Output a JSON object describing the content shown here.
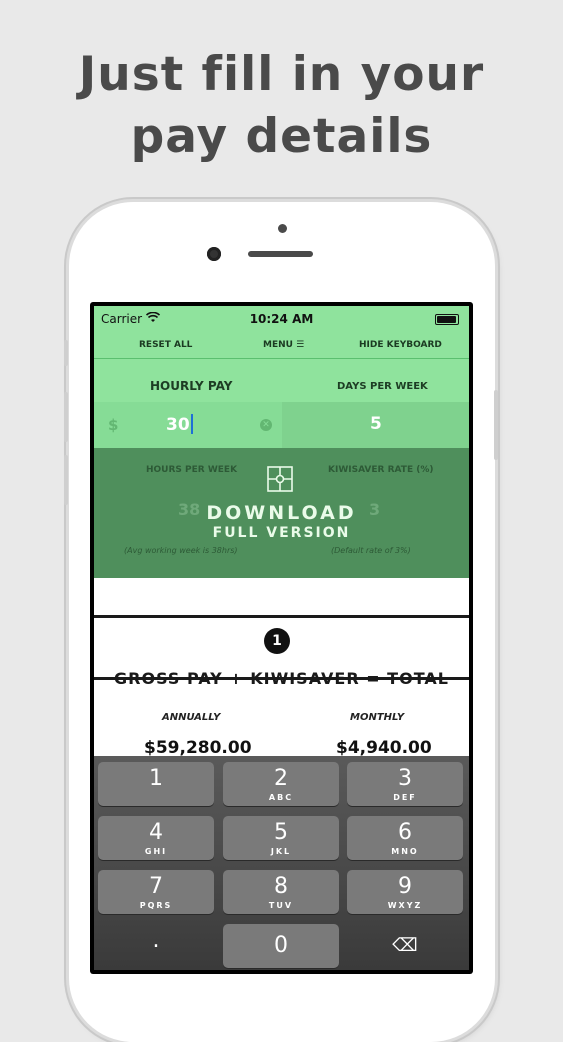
{
  "headline": {
    "line1": "Just fill in your",
    "line2": "pay details"
  },
  "status": {
    "carrier": "Carrier",
    "time": "10:24 AM",
    "wifi_icon": "wifi-icon",
    "battery_icon": "battery-icon"
  },
  "nav": {
    "reset": "RESET ALL",
    "menu": "MENU ☰",
    "hide": "HIDE KEYBOARD"
  },
  "fields": {
    "hourly_pay": {
      "label": "HOURLY PAY",
      "currency": "$",
      "value": "30"
    },
    "days_per_week": {
      "label": "DAYS PER WEEK",
      "value": "5"
    },
    "hours_per_week": {
      "label": "HOURS PER WEEK",
      "value": "38",
      "hint": "(Avg working week is 38hrs)"
    },
    "kiwisaver_rate": {
      "label": "KIWISAVER RATE (%)",
      "value": "3",
      "hint": "(Default rate of 3%)"
    }
  },
  "promo": {
    "line1": "DOWNLOAD",
    "line2": "FULL VERSION",
    "icon": "puzzle-icon"
  },
  "results": {
    "step": "1",
    "formula": "GROSS PAY + KIWISAVER = TOTAL",
    "annually_label": "ANNUALLY",
    "monthly_label": "MONTHLY",
    "annually_value": "$59,280.00",
    "monthly_value": "$4,940.00"
  },
  "keypad": [
    {
      "digit": "1",
      "letters": ""
    },
    {
      "digit": "2",
      "letters": "ABC"
    },
    {
      "digit": "3",
      "letters": "DEF"
    },
    {
      "digit": "4",
      "letters": "GHI"
    },
    {
      "digit": "5",
      "letters": "JKL"
    },
    {
      "digit": "6",
      "letters": "MNO"
    },
    {
      "digit": "7",
      "letters": "PQRS"
    },
    {
      "digit": "8",
      "letters": "TUV"
    },
    {
      "digit": "9",
      "letters": "WXYZ"
    },
    {
      "digit": ".",
      "letters": ""
    },
    {
      "digit": "0",
      "letters": ""
    },
    {
      "digit": "⌫",
      "letters": ""
    }
  ]
}
